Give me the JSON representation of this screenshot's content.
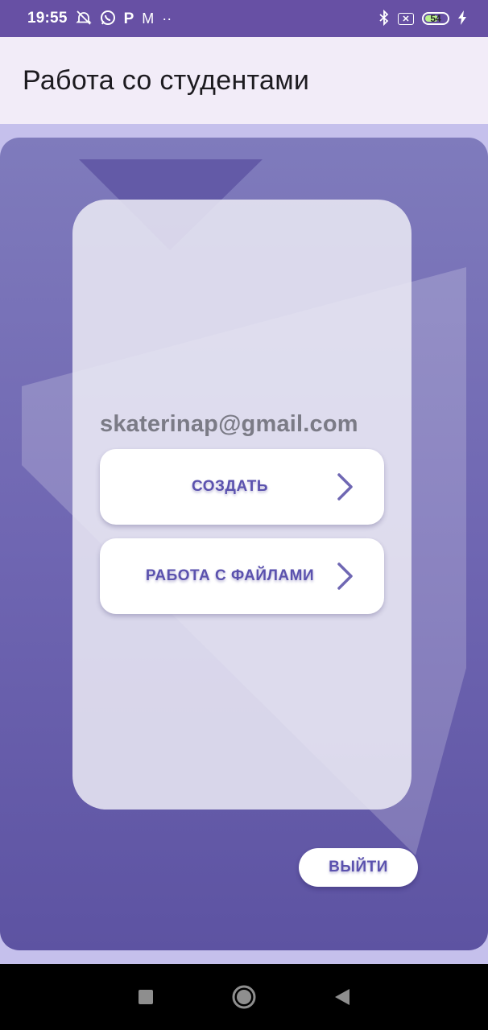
{
  "status_bar": {
    "time": "19:55",
    "left_icons": [
      "alarm-off-icon",
      "whatsapp-icon",
      "p-app-icon",
      "gmail-icon",
      "more-dots-icon"
    ],
    "right_icons": [
      "bluetooth-icon",
      "sim-x-icon",
      "battery-icon",
      "charging-icon"
    ],
    "battery_level": "54",
    "p_glyph": "P",
    "m_glyph": "M",
    "dots": "··"
  },
  "app_bar": {
    "title": "Работа со студентами"
  },
  "main": {
    "email": "skaterinap@gmail.com",
    "buttons": [
      {
        "label": "СОЗДАТЬ",
        "icon": "chevron-right-icon"
      },
      {
        "label": "РАБОТА С ФАЙЛАМИ",
        "icon": "chevron-right-icon"
      }
    ],
    "exit_label": "ВЫЙТИ"
  },
  "nav_bar": {
    "icons": [
      "recents-square-icon",
      "home-circle-icon",
      "back-triangle-icon"
    ]
  },
  "colors": {
    "status_bar": "#6750a4",
    "app_bar": "#f2ecf8",
    "accent_text": "#5b52ae",
    "panel_top": "#7f7bbc",
    "panel_bottom": "#5d53a2",
    "battery_fill": "#b8f08a"
  }
}
